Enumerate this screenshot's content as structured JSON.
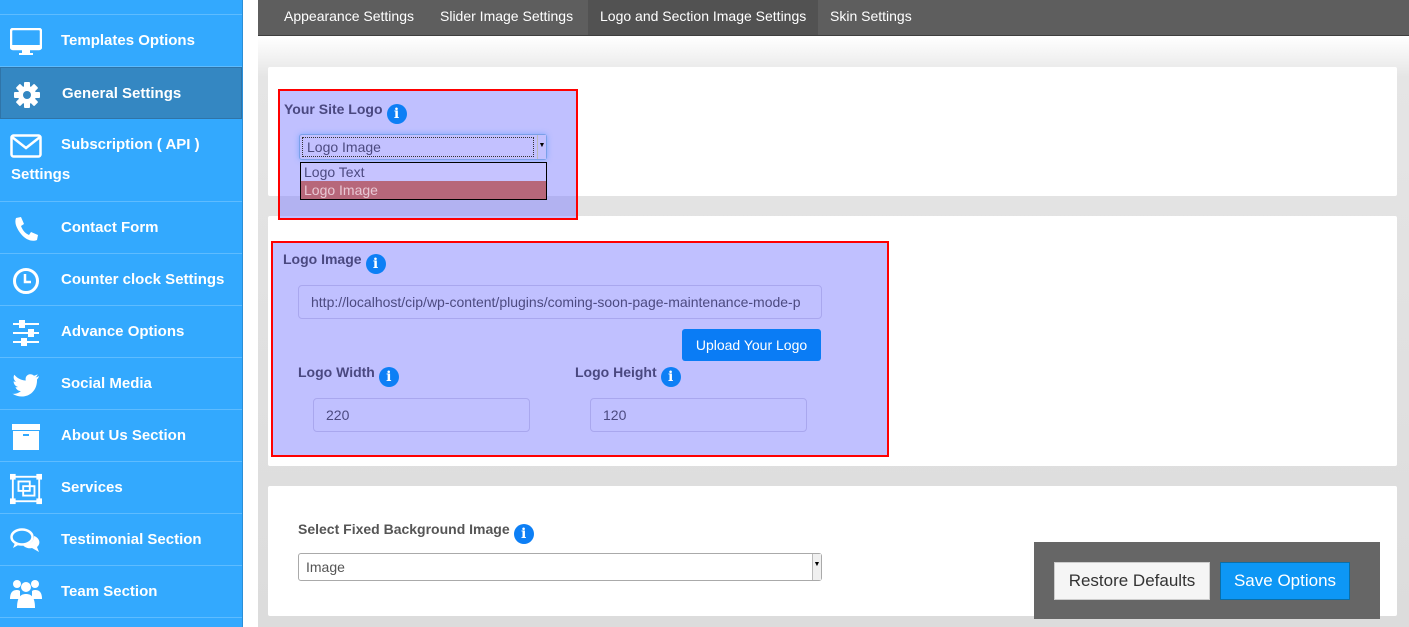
{
  "sidebar": {
    "items": [
      {
        "label": "Templates Options",
        "icon": "monitor-icon"
      },
      {
        "label": "General Settings",
        "icon": "gear-icon",
        "active": true
      },
      {
        "label": "Subscription ( API )",
        "label2": "Settings",
        "icon": "envelope-icon"
      },
      {
        "label": "Contact Form",
        "icon": "phone-icon"
      },
      {
        "label": "Counter clock Settings",
        "icon": "clock-icon"
      },
      {
        "label": "Advance Options",
        "icon": "sliders-icon"
      },
      {
        "label": "Social Media",
        "icon": "twitter-icon"
      },
      {
        "label": "About Us Section",
        "icon": "archive-box-icon"
      },
      {
        "label": "Services",
        "icon": "object-group-icon"
      },
      {
        "label": "Testimonial Section",
        "icon": "chat-bubbles-icon"
      },
      {
        "label": "Team Section",
        "icon": "users-icon"
      }
    ]
  },
  "tabs": [
    {
      "label": "Appearance Settings"
    },
    {
      "label": "Slider Image Settings"
    },
    {
      "label": "Logo and Section Image Settings",
      "active": true
    },
    {
      "label": "Skin Settings"
    }
  ],
  "site_logo": {
    "label": "Your Site Logo",
    "selected": "Logo Image",
    "options": [
      "Logo Text",
      "Logo Image"
    ]
  },
  "logo_image": {
    "label": "Logo Image",
    "url_value": "http://localhost/cip/wp-content/plugins/coming-soon-page-maintenance-mode-p",
    "upload_button": "Upload Your Logo",
    "width_label": "Logo Width",
    "width_value": "220",
    "height_label": "Logo Height",
    "height_value": "120"
  },
  "background": {
    "label": "Select Fixed Background Image",
    "selected": "Image"
  },
  "actions": {
    "restore": "Restore Defaults",
    "save": "Save Options"
  },
  "info_glyph": "i"
}
